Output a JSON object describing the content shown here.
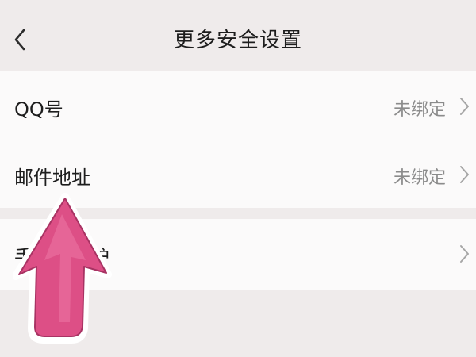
{
  "header": {
    "title": "更多安全设置",
    "back_icon": "chevron-left-icon"
  },
  "settings": {
    "items": [
      {
        "label": "QQ号",
        "value": "未绑定",
        "icon": "chevron-right-icon"
      },
      {
        "label": "邮件地址",
        "value": "未绑定",
        "icon": "chevron-right-icon"
      },
      {
        "label": "手机号防护",
        "value": "",
        "icon": "chevron-right-icon"
      }
    ]
  },
  "overlay": {
    "icon": "pink-arrow-up-icon",
    "color": "#dd4f86"
  }
}
